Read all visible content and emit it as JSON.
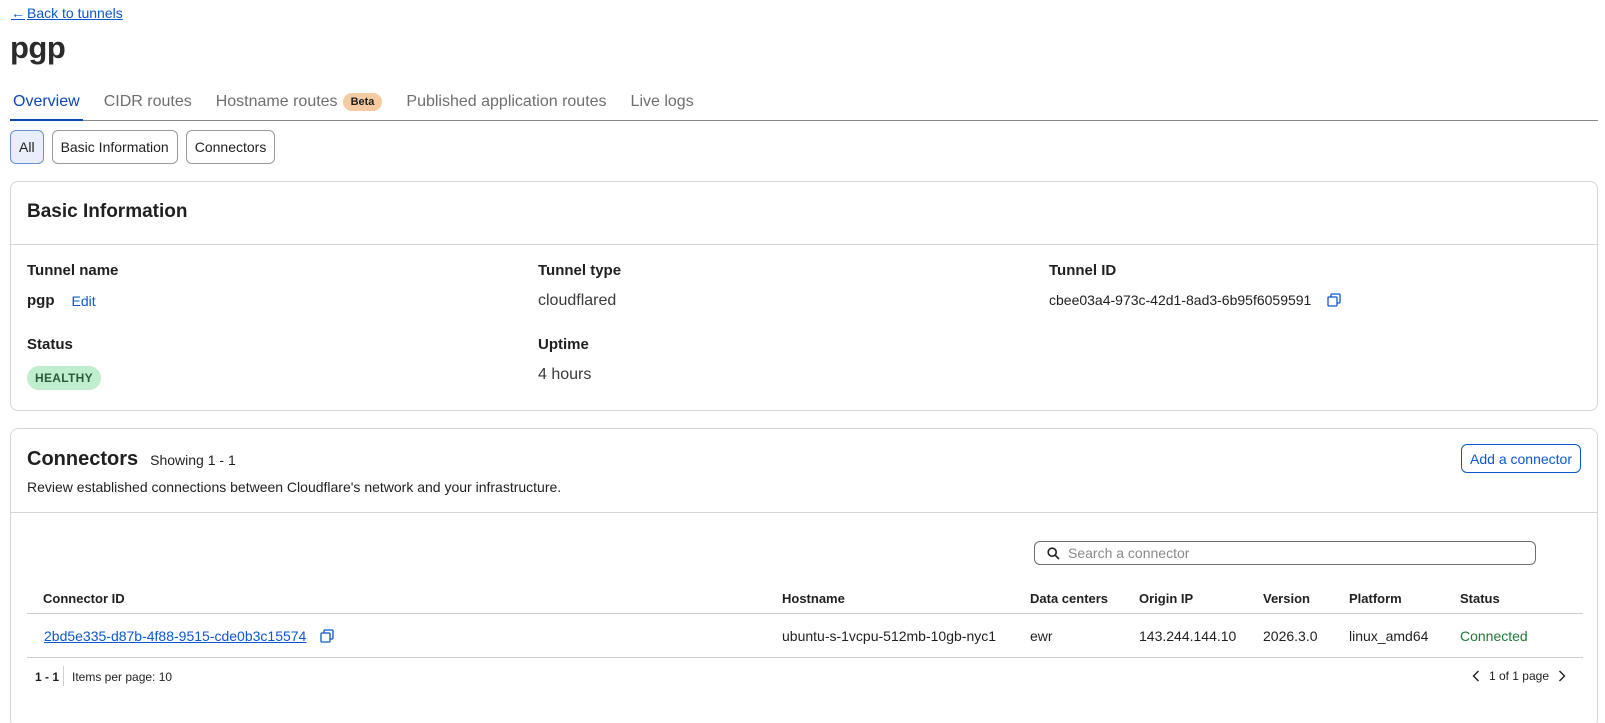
{
  "nav": {
    "back_label": "Back to tunnels"
  },
  "page": {
    "title": "pgp"
  },
  "tabs": [
    {
      "label": "Overview",
      "active": true
    },
    {
      "label": "CIDR routes"
    },
    {
      "label": "Hostname routes",
      "badge": "Beta"
    },
    {
      "label": "Published application routes"
    },
    {
      "label": "Live logs"
    }
  ],
  "filters": [
    {
      "label": "All",
      "active": true
    },
    {
      "label": "Basic Information"
    },
    {
      "label": "Connectors"
    }
  ],
  "basic_info": {
    "title": "Basic Information",
    "tunnel_name_label": "Tunnel name",
    "tunnel_name": "pgp",
    "edit_label": "Edit",
    "tunnel_type_label": "Tunnel type",
    "tunnel_type": "cloudflared",
    "tunnel_id_label": "Tunnel ID",
    "tunnel_id": "cbee03a4-973c-42d1-8ad3-6b95f6059591",
    "status_label": "Status",
    "status": "HEALTHY",
    "uptime_label": "Uptime",
    "uptime": "4 hours"
  },
  "connectors": {
    "title": "Connectors",
    "showing": "Showing 1 - 1",
    "description": "Review established connections between Cloudflare's network and your infrastructure.",
    "add_label": "Add a connector",
    "search_placeholder": "Search a connector",
    "columns": {
      "id": "Connector ID",
      "hostname": "Hostname",
      "data_centers": "Data centers",
      "origin_ip": "Origin IP",
      "version": "Version",
      "platform": "Platform",
      "status": "Status"
    },
    "rows": [
      {
        "id": "2bd5e335-d87b-4f88-9515-cde0b3c15574",
        "hostname": "ubuntu-s-1vcpu-512mb-10gb-nyc1",
        "data_centers": "ewr",
        "origin_ip": "143.244.144.10",
        "version": "2026.3.0",
        "platform": "linux_amd64",
        "status": "Connected"
      }
    ],
    "pagination": {
      "range": "1 - 1",
      "items_per_page": "Items per page: 10",
      "page_info": "1 of 1 page"
    }
  },
  "colors": {
    "link": "#0b57d0",
    "tab_active": "#0b46b4",
    "badge_healthy_bg": "#bfeecf",
    "beta_bg": "#f6cba1",
    "connected": "#1e7a34"
  },
  "icons": [
    "arrow-left-icon",
    "copy-icon",
    "search-icon",
    "chevron-left-icon",
    "chevron-right-icon"
  ]
}
